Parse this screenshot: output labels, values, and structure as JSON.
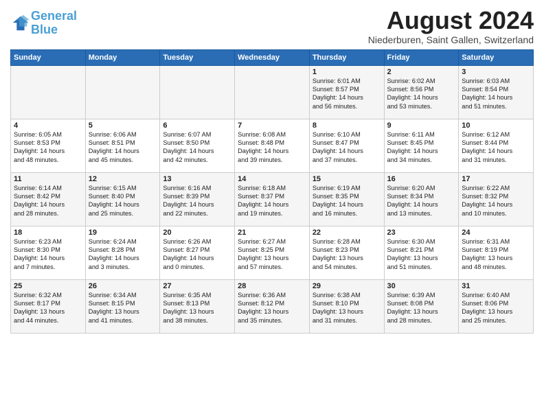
{
  "header": {
    "logo_line1": "General",
    "logo_line2": "Blue",
    "title": "August 2024",
    "location": "Niederburen, Saint Gallen, Switzerland"
  },
  "days_of_week": [
    "Sunday",
    "Monday",
    "Tuesday",
    "Wednesday",
    "Thursday",
    "Friday",
    "Saturday"
  ],
  "weeks": [
    [
      {
        "day": "",
        "info": ""
      },
      {
        "day": "",
        "info": ""
      },
      {
        "day": "",
        "info": ""
      },
      {
        "day": "",
        "info": ""
      },
      {
        "day": "1",
        "info": "Sunrise: 6:01 AM\nSunset: 8:57 PM\nDaylight: 14 hours\nand 56 minutes."
      },
      {
        "day": "2",
        "info": "Sunrise: 6:02 AM\nSunset: 8:56 PM\nDaylight: 14 hours\nand 53 minutes."
      },
      {
        "day": "3",
        "info": "Sunrise: 6:03 AM\nSunset: 8:54 PM\nDaylight: 14 hours\nand 51 minutes."
      }
    ],
    [
      {
        "day": "4",
        "info": "Sunrise: 6:05 AM\nSunset: 8:53 PM\nDaylight: 14 hours\nand 48 minutes."
      },
      {
        "day": "5",
        "info": "Sunrise: 6:06 AM\nSunset: 8:51 PM\nDaylight: 14 hours\nand 45 minutes."
      },
      {
        "day": "6",
        "info": "Sunrise: 6:07 AM\nSunset: 8:50 PM\nDaylight: 14 hours\nand 42 minutes."
      },
      {
        "day": "7",
        "info": "Sunrise: 6:08 AM\nSunset: 8:48 PM\nDaylight: 14 hours\nand 39 minutes."
      },
      {
        "day": "8",
        "info": "Sunrise: 6:10 AM\nSunset: 8:47 PM\nDaylight: 14 hours\nand 37 minutes."
      },
      {
        "day": "9",
        "info": "Sunrise: 6:11 AM\nSunset: 8:45 PM\nDaylight: 14 hours\nand 34 minutes."
      },
      {
        "day": "10",
        "info": "Sunrise: 6:12 AM\nSunset: 8:44 PM\nDaylight: 14 hours\nand 31 minutes."
      }
    ],
    [
      {
        "day": "11",
        "info": "Sunrise: 6:14 AM\nSunset: 8:42 PM\nDaylight: 14 hours\nand 28 minutes."
      },
      {
        "day": "12",
        "info": "Sunrise: 6:15 AM\nSunset: 8:40 PM\nDaylight: 14 hours\nand 25 minutes."
      },
      {
        "day": "13",
        "info": "Sunrise: 6:16 AM\nSunset: 8:39 PM\nDaylight: 14 hours\nand 22 minutes."
      },
      {
        "day": "14",
        "info": "Sunrise: 6:18 AM\nSunset: 8:37 PM\nDaylight: 14 hours\nand 19 minutes."
      },
      {
        "day": "15",
        "info": "Sunrise: 6:19 AM\nSunset: 8:35 PM\nDaylight: 14 hours\nand 16 minutes."
      },
      {
        "day": "16",
        "info": "Sunrise: 6:20 AM\nSunset: 8:34 PM\nDaylight: 14 hours\nand 13 minutes."
      },
      {
        "day": "17",
        "info": "Sunrise: 6:22 AM\nSunset: 8:32 PM\nDaylight: 14 hours\nand 10 minutes."
      }
    ],
    [
      {
        "day": "18",
        "info": "Sunrise: 6:23 AM\nSunset: 8:30 PM\nDaylight: 14 hours\nand 7 minutes."
      },
      {
        "day": "19",
        "info": "Sunrise: 6:24 AM\nSunset: 8:28 PM\nDaylight: 14 hours\nand 3 minutes."
      },
      {
        "day": "20",
        "info": "Sunrise: 6:26 AM\nSunset: 8:27 PM\nDaylight: 14 hours\nand 0 minutes."
      },
      {
        "day": "21",
        "info": "Sunrise: 6:27 AM\nSunset: 8:25 PM\nDaylight: 13 hours\nand 57 minutes."
      },
      {
        "day": "22",
        "info": "Sunrise: 6:28 AM\nSunset: 8:23 PM\nDaylight: 13 hours\nand 54 minutes."
      },
      {
        "day": "23",
        "info": "Sunrise: 6:30 AM\nSunset: 8:21 PM\nDaylight: 13 hours\nand 51 minutes."
      },
      {
        "day": "24",
        "info": "Sunrise: 6:31 AM\nSunset: 8:19 PM\nDaylight: 13 hours\nand 48 minutes."
      }
    ],
    [
      {
        "day": "25",
        "info": "Sunrise: 6:32 AM\nSunset: 8:17 PM\nDaylight: 13 hours\nand 44 minutes."
      },
      {
        "day": "26",
        "info": "Sunrise: 6:34 AM\nSunset: 8:15 PM\nDaylight: 13 hours\nand 41 minutes."
      },
      {
        "day": "27",
        "info": "Sunrise: 6:35 AM\nSunset: 8:13 PM\nDaylight: 13 hours\nand 38 minutes."
      },
      {
        "day": "28",
        "info": "Sunrise: 6:36 AM\nSunset: 8:12 PM\nDaylight: 13 hours\nand 35 minutes."
      },
      {
        "day": "29",
        "info": "Sunrise: 6:38 AM\nSunset: 8:10 PM\nDaylight: 13 hours\nand 31 minutes."
      },
      {
        "day": "30",
        "info": "Sunrise: 6:39 AM\nSunset: 8:08 PM\nDaylight: 13 hours\nand 28 minutes."
      },
      {
        "day": "31",
        "info": "Sunrise: 6:40 AM\nSunset: 8:06 PM\nDaylight: 13 hours\nand 25 minutes."
      }
    ]
  ]
}
